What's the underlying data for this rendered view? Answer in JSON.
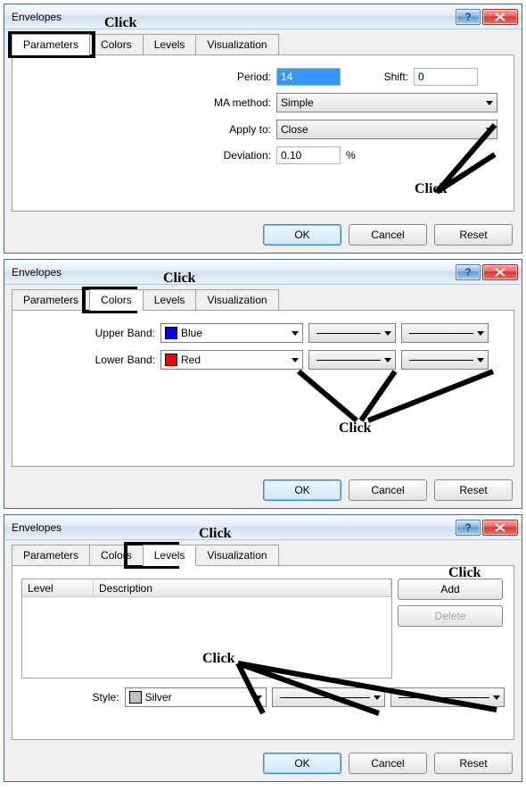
{
  "dialog1": {
    "title": "Envelopes",
    "tabs": [
      "Parameters",
      "Colors",
      "Levels",
      "Visualization"
    ],
    "activeTab": 0,
    "labels": {
      "period": "Period:",
      "shift": "Shift:",
      "ma": "MA method:",
      "apply": "Apply to:",
      "deviation": "Deviation:",
      "percent": "%"
    },
    "values": {
      "period": "14",
      "shift": "0",
      "ma": "Simple",
      "apply": "Close",
      "deviation": "0.10"
    },
    "buttons": {
      "ok": "OK",
      "cancel": "Cancel",
      "reset": "Reset"
    },
    "anno": {
      "click_top": "Click",
      "click_right": "Click"
    }
  },
  "dialog2": {
    "title": "Envelopes",
    "tabs": [
      "Parameters",
      "Colors",
      "Levels",
      "Visualization"
    ],
    "activeTab": 1,
    "labels": {
      "upper": "Upper Band:",
      "lower": "Lower Band:"
    },
    "values": {
      "upper_color_name": "Blue",
      "upper_color": "#0000ff",
      "lower_color_name": "Red",
      "lower_color": "#ff0000"
    },
    "buttons": {
      "ok": "OK",
      "cancel": "Cancel",
      "reset": "Reset"
    },
    "anno": {
      "click_top": "Click",
      "click_bottom": "Click"
    }
  },
  "dialog3": {
    "title": "Envelopes",
    "tabs": [
      "Parameters",
      "Colors",
      "Levels",
      "Visualization"
    ],
    "activeTab": 2,
    "labels": {
      "level": "Level",
      "description": "Description",
      "style": "Style:"
    },
    "values": {
      "style_color_name": "Silver",
      "style_color": "#c0c0c0"
    },
    "buttons": {
      "ok": "OK",
      "cancel": "Cancel",
      "reset": "Reset",
      "add": "Add",
      "delete": "Delete"
    },
    "anno": {
      "click_top": "Click",
      "click_right": "Click",
      "click_center": "Click"
    }
  }
}
